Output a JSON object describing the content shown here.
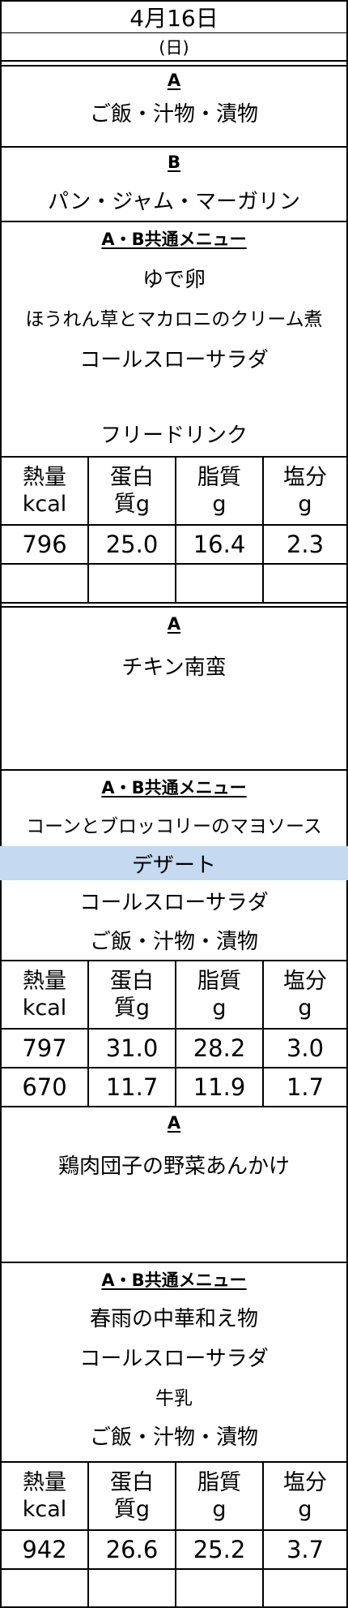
{
  "header": {
    "date": "4月16日",
    "weekday": "(日)"
  },
  "nutrition_headers": [
    {
      "line1": "熱量",
      "line2": "kcal"
    },
    {
      "line1": "蛋白",
      "line2": "質g"
    },
    {
      "line1": "脂質",
      "line2": "g"
    },
    {
      "line1": "塩分",
      "line2": "g"
    }
  ],
  "breakfast": {
    "a_label": "A",
    "a_item": "ご飯・汁物・漬物",
    "b_label": "B",
    "b_item": "パン・ジャム・マーガリン",
    "common_label": "A・B共通メニュー",
    "items": [
      "ゆで卵",
      "ほうれん草とマカロニのクリーム煮",
      "コールスローサラダ",
      "フリードリンク"
    ],
    "nutrition": [
      {
        "kcal": "796",
        "protein": "25.0",
        "fat": "16.4",
        "salt": "2.3"
      },
      {
        "kcal": "",
        "protein": "",
        "fat": "",
        "salt": ""
      }
    ]
  },
  "lunch": {
    "a_label": "A",
    "a_item": "チキン南蛮",
    "common_label": "A・B共通メニュー",
    "items": [
      "コーンとブロッコリーのマヨソース",
      "デザート",
      "コールスローサラダ",
      "ご飯・汁物・漬物"
    ],
    "nutrition": [
      {
        "kcal": "797",
        "protein": "31.0",
        "fat": "28.2",
        "salt": "3.0"
      },
      {
        "kcal": "670",
        "protein": "11.7",
        "fat": "11.9",
        "salt": "1.7"
      }
    ]
  },
  "dinner": {
    "a_label": "A",
    "a_item": "鶏肉団子の野菜あんかけ",
    "common_label": "A・B共通メニュー",
    "items": [
      "春雨の中華和え物",
      "コールスローサラダ",
      "牛乳",
      "ご飯・汁物・漬物"
    ],
    "nutrition": [
      {
        "kcal": "942",
        "protein": "26.6",
        "fat": "25.2",
        "salt": "3.7"
      },
      {
        "kcal": "",
        "protein": "",
        "fat": "",
        "salt": ""
      }
    ]
  },
  "colors": {
    "highlight": "#c5d9f1",
    "border": "#000000"
  }
}
